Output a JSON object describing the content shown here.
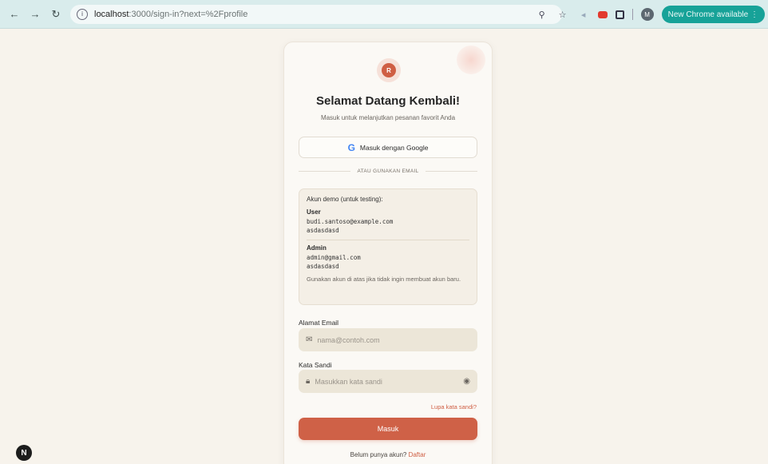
{
  "browser": {
    "url_host": "localhost",
    "url_path": ":3000/sign-in?next=%2Fprofile",
    "update_label": "New Chrome available",
    "profile_initial": "M",
    "more_icon": "⋮"
  },
  "card": {
    "logo_letter": "R",
    "title": "Selamat Datang Kembali!",
    "subtitle": "Masuk untuk melanjutkan pesanan favorit Anda",
    "google_label": "Masuk dengan Google",
    "divider_text": "ATAU GUNAKAN EMAIL"
  },
  "demo": {
    "heading": "Akun demo (untuk testing):",
    "accounts": [
      {
        "role": "User",
        "email": "budi.santoso@example.com",
        "password": "asdasdasd"
      },
      {
        "role": "Admin",
        "email": "admin@gmail.com",
        "password": "asdasdasd"
      }
    ],
    "note": "Gunakan akun di atas jika tidak ingin membuat akun baru."
  },
  "form": {
    "email_label": "Alamat Email",
    "email_placeholder": "nama@contoh.com",
    "password_label": "Kata Sandi",
    "password_placeholder": "Masukkan kata sandi",
    "forgot_label": "Lupa kata sandi?",
    "submit_label": "Masuk",
    "signup_prompt": "Belum punya akun?",
    "signup_link": "Daftar"
  },
  "dev": {
    "badge_letter": "N"
  },
  "colors": {
    "accent": "#cf6147",
    "update_pill": "#17a298",
    "background": "#f7f3ec"
  }
}
